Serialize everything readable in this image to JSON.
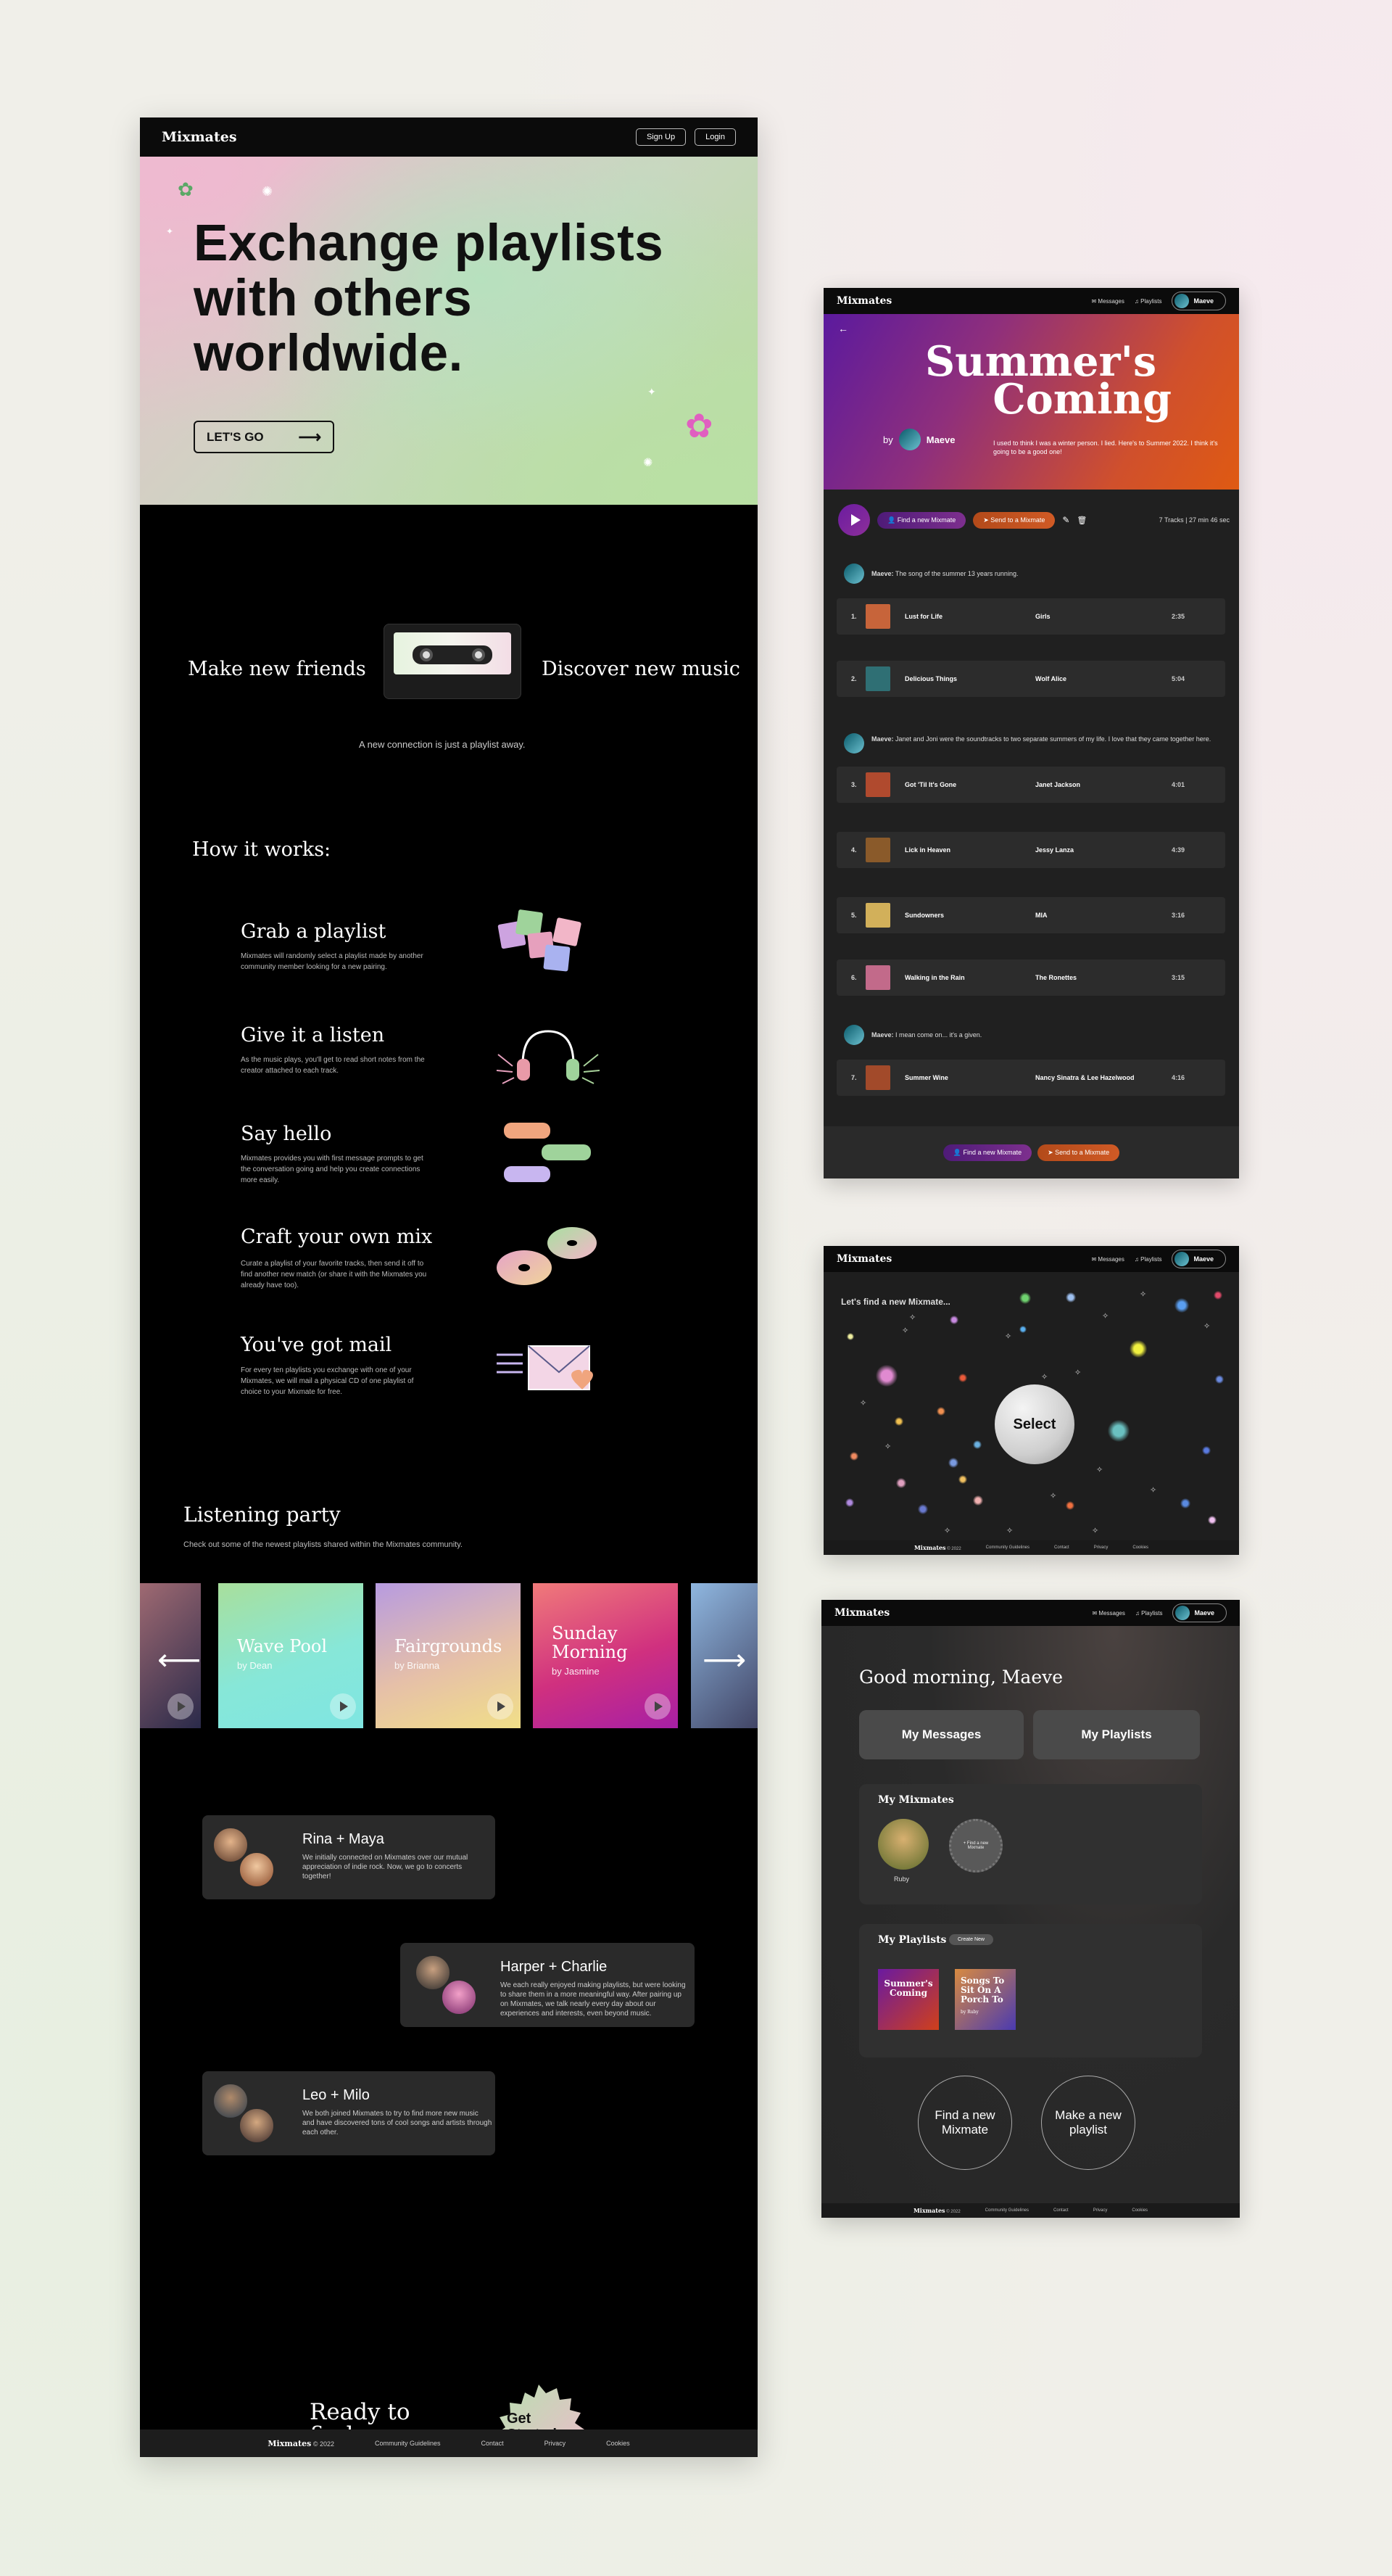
{
  "brand": "Mixmates",
  "landing": {
    "nav": {
      "signup": "Sign Up",
      "login": "Login"
    },
    "hero_title": "Exchange playlists with others worldwide.",
    "cta": "LET'S GO",
    "friends": "Make new friends",
    "discover": "Discover new music",
    "tagline": "A new connection is just a playlist away.",
    "how_title": "How it works:",
    "steps": [
      {
        "title": "Grab a playlist",
        "desc": "Mixmates will randomly select a playlist made by another community member looking for a new pairing."
      },
      {
        "title": "Give it a listen",
        "desc": "As the music plays, you'll get to read short notes from the creator attached to each track."
      },
      {
        "title": "Say hello",
        "desc": "Mixmates provides you with first message prompts to get the conversation going and help you create connections more easily."
      },
      {
        "title": "Craft your own mix",
        "desc": "Curate a playlist of your favorite tracks, then send it off to find another new match (or share it with the Mixmates you already have too)."
      },
      {
        "title": "You've got mail",
        "desc": "For every ten playlists you exchange with one of your Mixmates, we will mail a physical CD of one playlist of choice to your Mixmate for free."
      }
    ],
    "party_title": "Listening party",
    "party_sub": "Check out some of the newest playlists shared within the Mixmates community.",
    "cards": [
      {
        "title": "Wave Pool",
        "by": "by Dean"
      },
      {
        "title": "Fairgrounds",
        "by": "by Brianna"
      },
      {
        "title": "Sunday Morning",
        "by": "by Jasmine"
      }
    ],
    "testimonials": [
      {
        "names": "Rina + Maya",
        "text": "We initially connected on Mixmates over our mutual appreciation of indie rock. Now, we go to concerts together!"
      },
      {
        "names": "Harper + Charlie",
        "text": "We each really enjoyed making playlists, but were looking to share them in a more meaningful way. After pairing up on Mixmates, we talk nearly every day about our experiences and interests, even beyond music."
      },
      {
        "names": "Leo + Milo",
        "text": "We both joined Mixmates to try to find more new music and have discovered tons of cool songs and artists through each other."
      }
    ],
    "ready": "Ready to find your new Mixmates?",
    "badge": "Get Started",
    "footer": {
      "copyright": "© 2022",
      "links": [
        "Community Guidelines",
        "Contact",
        "Privacy",
        "Cookies"
      ]
    }
  },
  "app_nav": {
    "messages": "Messages",
    "playlists": "Playlists",
    "user": "Maeve"
  },
  "playlist": {
    "title_line1": "Summer's",
    "title_line2": "Coming",
    "by": "by",
    "author": "Maeve",
    "description": "I used to think I was a winter person. I lied. Here's to Summer 2022. I think it's going to be a good one!",
    "find_btn": "Find a new Mixmate",
    "send_btn": "Send to a Mixmate",
    "meta": "7 Tracks  |  27 min 46 sec",
    "notes": [
      {
        "who": "Maeve:",
        "text": "The song of the summer 13 years running."
      },
      {
        "who": "Maeve:",
        "text": "Janet and Joni were the soundtracks to two separate summers of my life. I love that they came together here."
      },
      {
        "who": "Maeve:",
        "text": "I mean come on... it's a given."
      }
    ],
    "tracks": [
      {
        "n": "1.",
        "title": "Lust for Life",
        "artist": "Girls",
        "dur": "2:35",
        "color": "#c7643a"
      },
      {
        "n": "2.",
        "title": "Delicious Things",
        "artist": "Wolf Alice",
        "dur": "5:04",
        "color": "#2f6f74"
      },
      {
        "n": "3.",
        "title": "Got 'Til It's Gone",
        "artist": "Janet Jackson",
        "dur": "4:01",
        "color": "#b04a2e"
      },
      {
        "n": "4.",
        "title": "Lick in Heaven",
        "artist": "Jessy Lanza",
        "dur": "4:39",
        "color": "#8a5a2a"
      },
      {
        "n": "5.",
        "title": "Sundowners",
        "artist": "MIA",
        "dur": "3:16",
        "color": "#d2b05a"
      },
      {
        "n": "6.",
        "title": "Walking in the Rain",
        "artist": "The Ronettes",
        "dur": "3:15",
        "color": "#c26a8a"
      },
      {
        "n": "7.",
        "title": "Summer Wine",
        "artist": "Nancy Sinatra & Lee Hazelwood",
        "dur": "4:16",
        "color": "#a24a2a"
      }
    ]
  },
  "find": {
    "title": "Let's find a new Mixmate...",
    "select": "Select",
    "footer": {
      "copyright": "© 2022",
      "links": [
        "Community Guidelines",
        "Contact",
        "Privacy",
        "Cookies"
      ]
    }
  },
  "dashboard": {
    "greeting": "Good morning, Maeve",
    "messages_btn": "My Messages",
    "playlists_btn": "My Playlists",
    "mixmates_title": "My Mixmates",
    "mixmate_name": "Ruby",
    "find_mixmate_badge": "+ Find a new Mixmate",
    "playlists_title": "My Playlists",
    "create_new": "Create New",
    "covers": [
      {
        "title": "Summer's Coming"
      },
      {
        "title": "Songs To Sit On A Porch To",
        "by": "by Ruby"
      }
    ],
    "find_btn": "Find a new Mixmate",
    "make_btn": "Make a new playlist",
    "footer": {
      "copyright": "© 2022",
      "links": [
        "Community Guidelines",
        "Contact",
        "Privacy",
        "Cookies"
      ]
    }
  },
  "colors": {
    "accent_purple": "#6b1ca0",
    "accent_orange": "#df5a12",
    "hero_pink": "#efb9d0",
    "hero_green": "#b7dba0"
  }
}
